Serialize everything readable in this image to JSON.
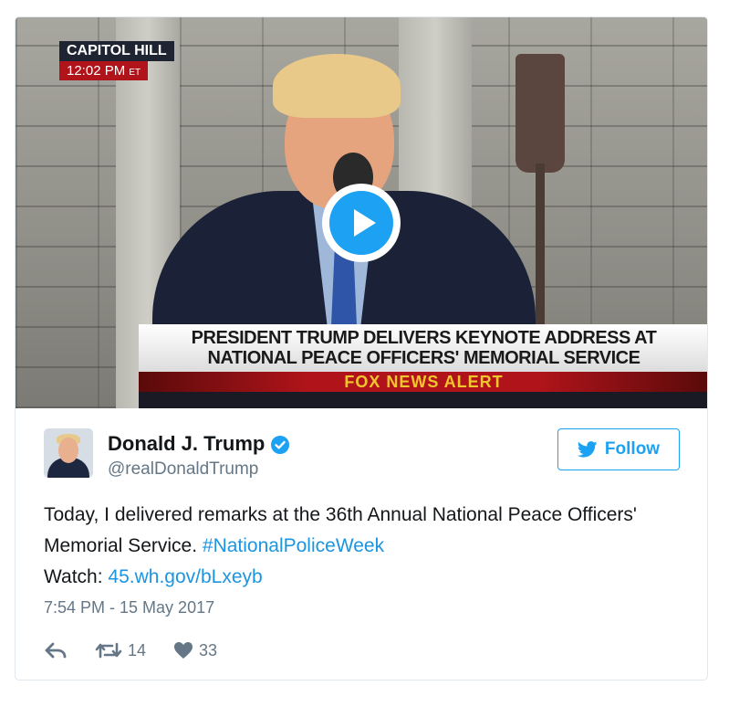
{
  "video": {
    "location": "CAPITOL HILL",
    "time": "12:02 PM",
    "timezone": "ET",
    "headline_line1": "PRESIDENT TRUMP DELIVERS KEYNOTE ADDRESS AT",
    "headline_line2": "NATIONAL PEACE OFFICERS' MEMORIAL SERVICE",
    "alert": "FOX NEWS ALERT",
    "play_icon": "play-icon"
  },
  "author": {
    "name": "Donald J. Trump",
    "handle": "@realDonaldTrump",
    "verified_icon": "verified-badge-icon"
  },
  "follow": {
    "label": "Follow",
    "icon": "twitter-bird-icon"
  },
  "tweet": {
    "text_part1": "Today, I delivered remarks at the 36th Annual National Peace Officers' Memorial Service.",
    "hashtag": "#NationalPoliceWeek",
    "watch_label": "Watch:",
    "link": "45.wh.gov/bLxeyb",
    "timestamp": "7:54 PM - 15 May 2017"
  },
  "actions": {
    "reply_icon": "reply-icon",
    "retweet_icon": "retweet-icon",
    "retweet_count": "14",
    "like_icon": "heart-icon",
    "like_count": "33"
  },
  "colors": {
    "accent": "#1da1f2",
    "link": "#1b95e0",
    "muted": "#657786",
    "fox_red": "#b0141a",
    "fox_yellow": "#f3c52d"
  }
}
